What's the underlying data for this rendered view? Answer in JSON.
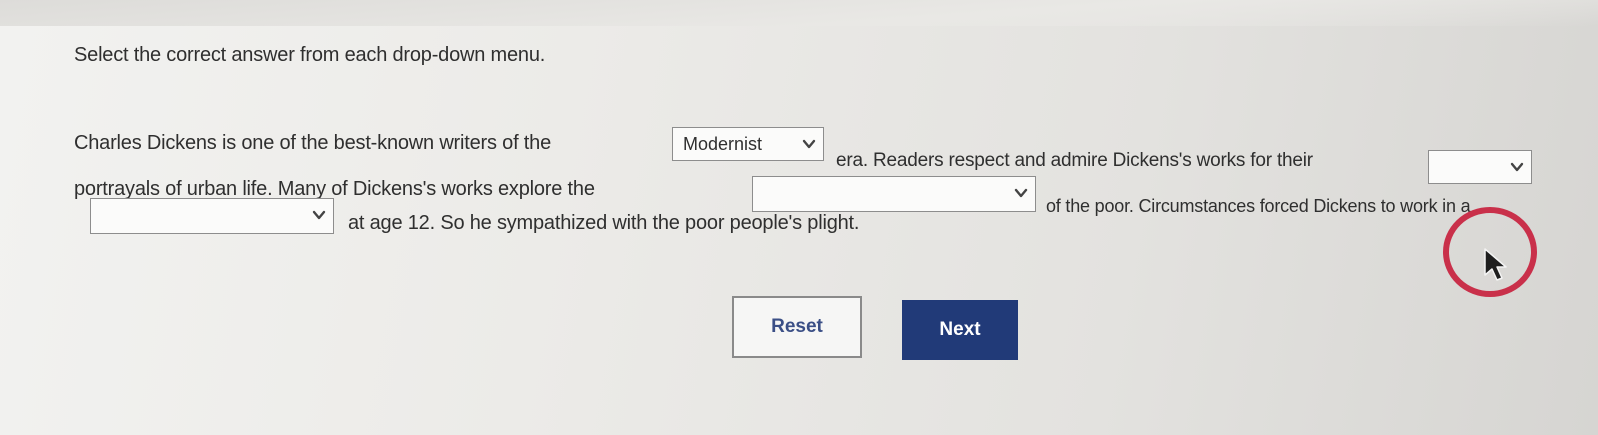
{
  "instruction": "Select the correct answer from each drop-down menu.",
  "passage": {
    "line1_a": "Charles Dickens is one of the best-known writers of the",
    "line1_b": "era. Readers respect and admire Dickens's works for their",
    "line2_a": "portrayals of urban life. Many of Dickens's works explore the",
    "line2_b": "of the poor. Circumstances forced Dickens to work in a",
    "line3_a": "at age 12. So he sympathized with the poor people's plight."
  },
  "dropdowns": {
    "era": {
      "selected": "Modernist"
    },
    "quality": {
      "selected": ""
    },
    "theme": {
      "selected": ""
    },
    "workplace": {
      "selected": ""
    }
  },
  "buttons": {
    "reset": "Reset",
    "next": "Next"
  },
  "colors": {
    "next_bg": "#213a78",
    "reset_text": "#3b4f86",
    "annotation": "#c9304a"
  },
  "icons": {
    "dropdown_chevron": "chevron-down-icon",
    "cursor": "mouse-pointer-icon",
    "annotation": "highlight-circle-icon"
  }
}
